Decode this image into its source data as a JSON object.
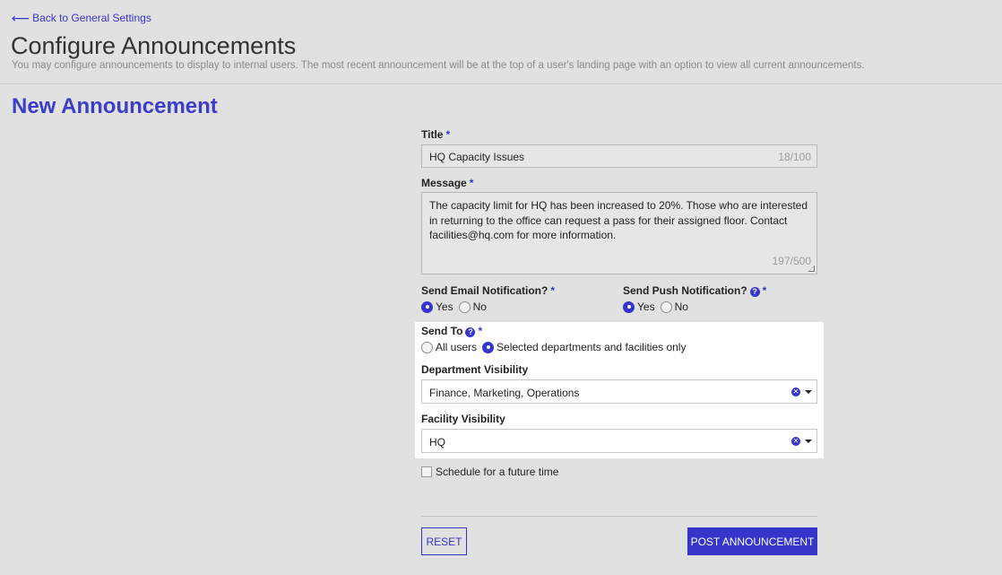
{
  "nav": {
    "back_label": "Back to General Settings"
  },
  "page": {
    "title": "Configure Announcements",
    "subtitle": "You may configure announcements to display to internal users. The most recent announcement will be at the top of a user's landing page with an option to view all current announcements."
  },
  "section": {
    "title": "New Announcement"
  },
  "form": {
    "title_label": "Title",
    "title_value": "HQ Capacity Issues",
    "title_counter": "18/100",
    "message_label": "Message",
    "message_value": "The capacity limit for HQ has been increased to 20%. Those who are interested in returning to the office can request a pass for their assigned floor. Contact facilities@hq.com for more information.",
    "message_counter": "197/500",
    "email_label": "Send Email Notification?",
    "email_options": [
      {
        "label": "Yes",
        "selected": true
      },
      {
        "label": "No",
        "selected": false
      }
    ],
    "push_label": "Send Push Notification?",
    "push_options": [
      {
        "label": "Yes",
        "selected": true
      },
      {
        "label": "No",
        "selected": false
      }
    ],
    "send_to_label": "Send To",
    "send_to_options": [
      {
        "label": "All users",
        "selected": false
      },
      {
        "label": "Selected departments and facilities only",
        "selected": true
      }
    ],
    "department_label": "Department Visibility",
    "department_value": "Finance, Marketing, Operations",
    "facility_label": "Facility Visibility",
    "facility_value": "HQ",
    "schedule_label": "Schedule for a future time",
    "schedule_checked": false,
    "required_mark": "*"
  },
  "actions": {
    "reset_label": "RESET",
    "post_label": "POST ANNOUNCEMENT"
  },
  "colors": {
    "accent": "#3535c9",
    "background": "#e2e1e2",
    "panel": "#ffffff"
  },
  "icons": {
    "back": "arrow-left-icon",
    "help": "question-circle-icon",
    "clear": "clear-icon",
    "caret": "caret-down-icon"
  }
}
